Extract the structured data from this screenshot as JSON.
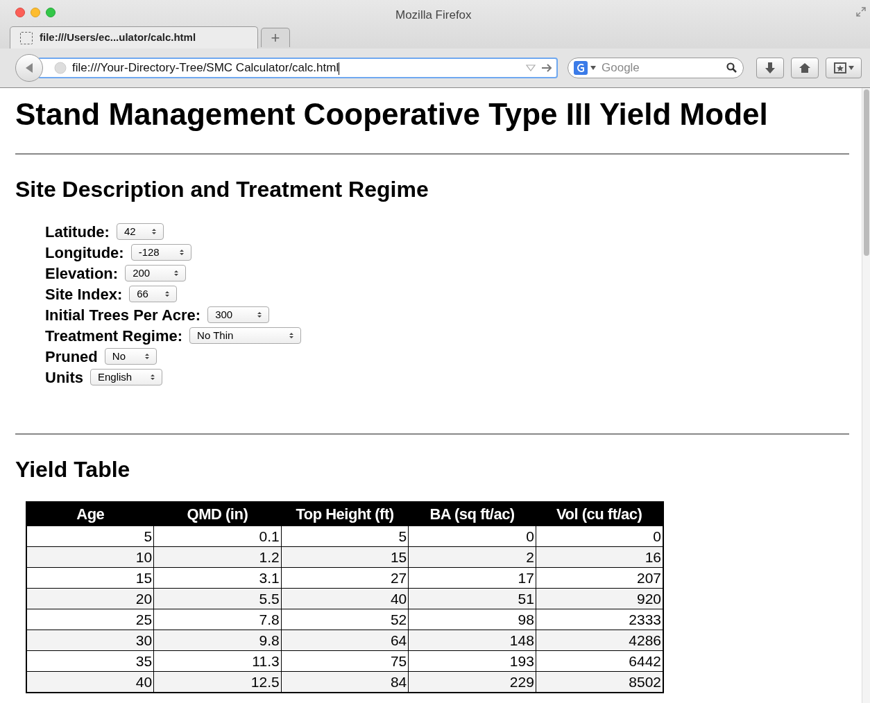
{
  "window": {
    "title": "Mozilla Firefox"
  },
  "tabs": [
    {
      "label": "file:///Users/ec...ulator/calc.html",
      "selected": true
    }
  ],
  "new_tab": "+",
  "address_bar": {
    "value": "file:///Your-Directory-Tree/SMC Calculator/calc.html"
  },
  "search": {
    "placeholder": "Google"
  },
  "page": {
    "title": "Stand Management Cooperative Type III Yield Model",
    "site_section": {
      "heading": "Site Description and Treatment Regime",
      "fields": [
        {
          "label": "Latitude:",
          "value": "42"
        },
        {
          "label": "Longitude:",
          "value": "-128"
        },
        {
          "label": "Elevation:",
          "value": "200"
        },
        {
          "label": "Site Index:",
          "value": "66"
        },
        {
          "label": "Initial Trees Per Acre:",
          "value": "300"
        },
        {
          "label": "Treatment Regime:",
          "value": "No Thin"
        },
        {
          "label": "Pruned",
          "value": "No"
        },
        {
          "label": "Units",
          "value": "English"
        }
      ]
    },
    "yield_section": {
      "heading": "Yield Table",
      "table": {
        "columns": [
          "Age",
          "QMD (in)",
          "Top Height (ft)",
          "BA (sq ft/ac)",
          "Vol (cu ft/ac)"
        ],
        "rows": [
          [
            "5",
            "0.1",
            "5",
            "0",
            "0"
          ],
          [
            "10",
            "1.2",
            "15",
            "2",
            "16"
          ],
          [
            "15",
            "3.1",
            "27",
            "17",
            "207"
          ],
          [
            "20",
            "5.5",
            "40",
            "51",
            "920"
          ],
          [
            "25",
            "7.8",
            "52",
            "98",
            "2333"
          ],
          [
            "30",
            "9.8",
            "64",
            "148",
            "4286"
          ],
          [
            "35",
            "11.3",
            "75",
            "193",
            "6442"
          ],
          [
            "40",
            "12.5",
            "84",
            "229",
            "8502"
          ]
        ]
      }
    }
  }
}
